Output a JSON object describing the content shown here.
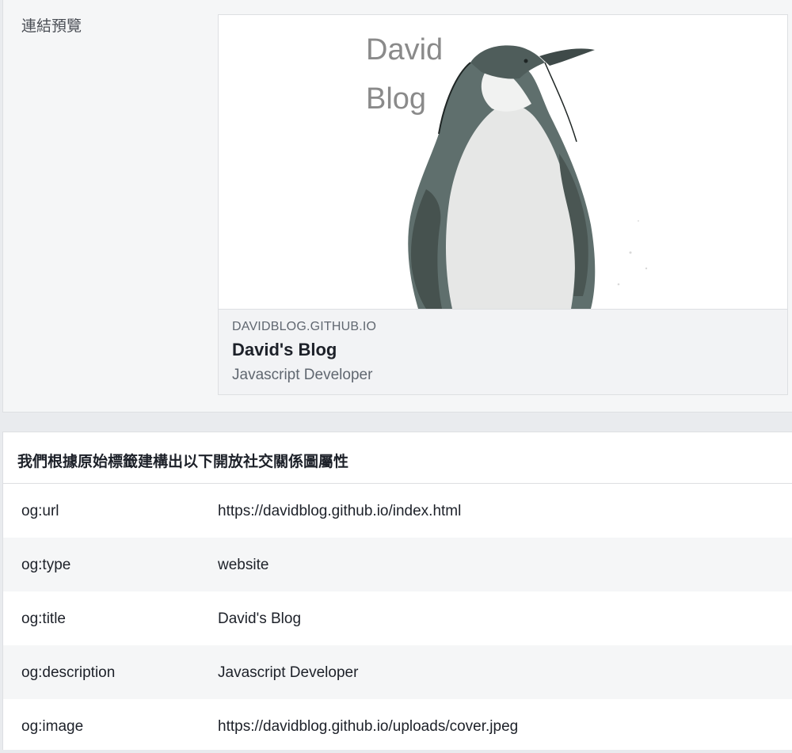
{
  "preview": {
    "label": "連結預覽",
    "card": {
      "image_overlay": {
        "line1": "David",
        "line2": "Blog"
      },
      "domain": "DAVIDBLOG.GITHUB.IO",
      "title": "David's Blog",
      "description": "Javascript Developer"
    }
  },
  "properties": {
    "heading": "我們根據原始標籤建構出以下開放社交關係圖屬性",
    "rows": [
      {
        "key": "og:url",
        "value": "https://davidblog.github.io/index.html"
      },
      {
        "key": "og:type",
        "value": "website"
      },
      {
        "key": "og:title",
        "value": "David's Blog"
      },
      {
        "key": "og:description",
        "value": "Javascript Developer"
      },
      {
        "key": "og:image",
        "value": "https://davidblog.github.io/uploads/cover.jpeg"
      }
    ]
  },
  "colors": {
    "page_bg": "#e9ebee",
    "panel_bg": "#f5f6f7",
    "card_meta_bg": "#f2f3f5",
    "penguin_body": "#5f6f6d"
  }
}
